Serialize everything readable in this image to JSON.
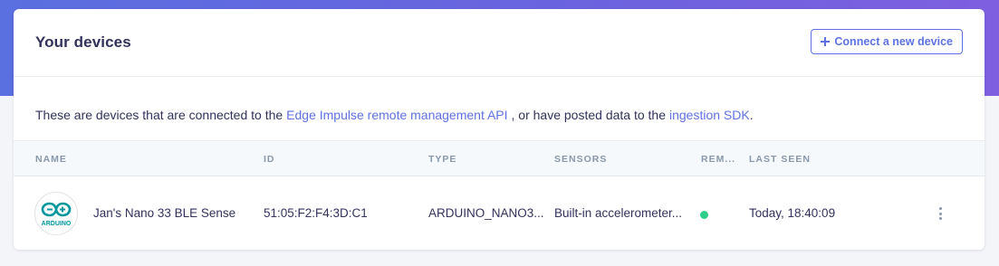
{
  "header": {
    "title": "Your devices",
    "connect_label": "Connect a new device"
  },
  "description": {
    "part1": "These are devices that are connected to the",
    "link1": "Edge Impulse remote management API",
    "part2": ", or have posted data to the",
    "link2": "ingestion SDK",
    "part3": "."
  },
  "table": {
    "columns": [
      "NAME",
      "ID",
      "TYPE",
      "SENSORS",
      "REM...",
      "LAST SEEN"
    ],
    "rows": [
      {
        "avatar_icon": "arduino-logo-icon",
        "avatar_text": "ARDUINO",
        "name": "Jan's Nano 33 BLE Sense",
        "id": "51:05:F2:F4:3D:C1",
        "type": "ARDUINO_NANO3...",
        "sensors": "Built-in accelerometer...",
        "remote_status": "connected",
        "last_seen": "Today, 18:40:09"
      }
    ]
  },
  "colors": {
    "accent": "#5e72e4",
    "status_online": "#2dce89",
    "arduino_teal": "#00979d"
  }
}
